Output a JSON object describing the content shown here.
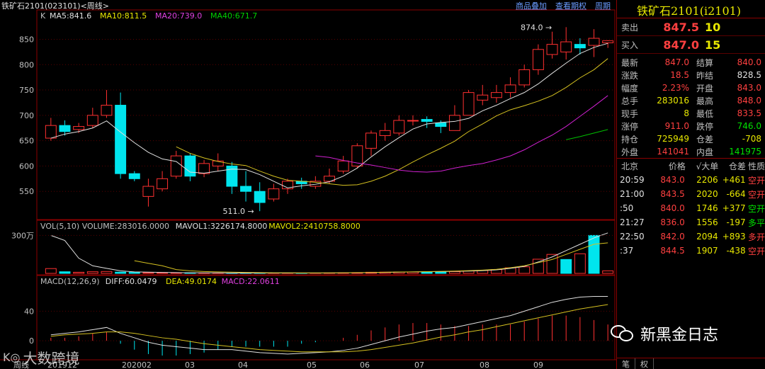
{
  "header": {
    "title": "铁矿石2101(023101)<周线>",
    "links": [
      "商品叠加",
      "查看期权",
      "周期"
    ],
    "k_label": "K"
  },
  "legends": {
    "ma": [
      {
        "text": "MA5:841.6",
        "color": "#e0e0e0"
      },
      {
        "text": "MA10:811.5",
        "color": "#e8e800"
      },
      {
        "text": "MA20:739.0",
        "color": "#e040e0"
      },
      {
        "text": "MA40:671.7",
        "color": "#00d000"
      }
    ],
    "vol": [
      {
        "text": "VOL(5,10) VOLUME:283016.0000",
        "color": "#c0c0c0"
      },
      {
        "text": "MAVOL1:3226174.8000",
        "color": "#e0e0e0"
      },
      {
        "text": "MAVOL2:2410758.8000",
        "color": "#e8e800"
      }
    ],
    "macd": [
      {
        "text": "MACD(12,26,9)",
        "color": "#c0c0c0"
      },
      {
        "text": "DIFF:60.0479",
        "color": "#e0e0e0"
      },
      {
        "text": "DEA:49.0174",
        "color": "#e8e800"
      },
      {
        "text": "MACD:22.0611",
        "color": "#e040e0"
      }
    ]
  },
  "axes": {
    "price_ticks": [
      "850",
      "800",
      "750",
      "700",
      "650",
      "600",
      "550"
    ],
    "vol_tick": "300万",
    "macd_ticks": [
      "40",
      "0"
    ],
    "x_labels": [
      "201912",
      "202002",
      "03",
      "04",
      "05",
      "06",
      "07",
      "08",
      "09"
    ],
    "x_corner": "周线"
  },
  "annotations": {
    "high": "874.0",
    "low": "511.0"
  },
  "chart_data": {
    "type": "candlestick",
    "title": "铁矿石2101(023101)<周线>",
    "ylim": [
      500,
      880
    ],
    "candles": [
      {
        "o": 655,
        "c": 680,
        "h": 695,
        "l": 650
      },
      {
        "o": 680,
        "c": 668,
        "h": 690,
        "l": 660
      },
      {
        "o": 672,
        "c": 678,
        "h": 685,
        "l": 665
      },
      {
        "o": 680,
        "c": 700,
        "h": 715,
        "l": 675
      },
      {
        "o": 700,
        "c": 720,
        "h": 750,
        "l": 695
      },
      {
        "o": 720,
        "c": 585,
        "h": 745,
        "l": 575
      },
      {
        "o": 585,
        "c": 575,
        "h": 590,
        "l": 570
      },
      {
        "o": 540,
        "c": 560,
        "h": 575,
        "l": 520
      },
      {
        "o": 555,
        "c": 575,
        "h": 590,
        "l": 550
      },
      {
        "o": 580,
        "c": 620,
        "h": 630,
        "l": 575
      },
      {
        "o": 620,
        "c": 580,
        "h": 625,
        "l": 570
      },
      {
        "o": 585,
        "c": 605,
        "h": 612,
        "l": 578
      },
      {
        "o": 600,
        "c": 610,
        "h": 625,
        "l": 590
      },
      {
        "o": 600,
        "c": 560,
        "h": 608,
        "l": 545
      },
      {
        "o": 560,
        "c": 550,
        "h": 590,
        "l": 530
      },
      {
        "o": 550,
        "c": 528,
        "h": 568,
        "l": 511
      },
      {
        "o": 535,
        "c": 555,
        "h": 565,
        "l": 530
      },
      {
        "o": 555,
        "c": 570,
        "h": 575,
        "l": 545
      },
      {
        "o": 570,
        "c": 565,
        "h": 577,
        "l": 555
      },
      {
        "o": 560,
        "c": 570,
        "h": 580,
        "l": 555
      },
      {
        "o": 570,
        "c": 580,
        "h": 595,
        "l": 565
      },
      {
        "o": 590,
        "c": 610,
        "h": 620,
        "l": 585
      },
      {
        "o": 600,
        "c": 640,
        "h": 645,
        "l": 595
      },
      {
        "o": 635,
        "c": 665,
        "h": 670,
        "l": 620
      },
      {
        "o": 660,
        "c": 670,
        "h": 685,
        "l": 650
      },
      {
        "o": 665,
        "c": 690,
        "h": 700,
        "l": 660
      },
      {
        "o": 690,
        "c": 690,
        "h": 700,
        "l": 680
      },
      {
        "o": 692,
        "c": 688,
        "h": 698,
        "l": 675
      },
      {
        "o": 685,
        "c": 678,
        "h": 690,
        "l": 665
      },
      {
        "o": 670,
        "c": 700,
        "h": 720,
        "l": 670
      },
      {
        "o": 700,
        "c": 745,
        "h": 750,
        "l": 700
      },
      {
        "o": 730,
        "c": 740,
        "h": 760,
        "l": 720
      },
      {
        "o": 735,
        "c": 745,
        "h": 760,
        "l": 725
      },
      {
        "o": 745,
        "c": 760,
        "h": 775,
        "l": 735
      },
      {
        "o": 760,
        "c": 790,
        "h": 800,
        "l": 755
      },
      {
        "o": 790,
        "c": 830,
        "h": 840,
        "l": 780
      },
      {
        "o": 820,
        "c": 840,
        "h": 865,
        "l": 812
      },
      {
        "o": 825,
        "c": 845,
        "h": 874,
        "l": 810
      },
      {
        "o": 840,
        "c": 833,
        "h": 852,
        "l": 820
      },
      {
        "o": 838,
        "c": 852,
        "h": 870,
        "l": 815
      },
      {
        "o": 843,
        "c": 847,
        "h": 848,
        "l": 833
      }
    ],
    "ma5": [
      655,
      663,
      668,
      675,
      689,
      667,
      646,
      627,
      614,
      609,
      588,
      586,
      590,
      594,
      593,
      583,
      570,
      557,
      561,
      564,
      569,
      580,
      596,
      618,
      638,
      656,
      673,
      683,
      686,
      688,
      694,
      709,
      720,
      733,
      745,
      762,
      783,
      803,
      822,
      834,
      842
    ],
    "ma10": [
      null,
      null,
      null,
      null,
      null,
      null,
      null,
      null,
      null,
      638,
      625,
      616,
      609,
      604,
      601,
      590,
      580,
      572,
      570,
      568,
      565,
      562,
      563,
      570,
      580,
      593,
      608,
      622,
      635,
      649,
      668,
      683,
      699,
      711,
      719,
      728,
      739,
      755,
      774,
      790,
      812
    ],
    "ma20": [
      null,
      null,
      null,
      null,
      null,
      null,
      null,
      null,
      null,
      null,
      null,
      null,
      null,
      null,
      null,
      null,
      null,
      null,
      null,
      620,
      617,
      611,
      606,
      602,
      597,
      592,
      589,
      588,
      590,
      596,
      601,
      605,
      612,
      620,
      632,
      647,
      661,
      678,
      698,
      718,
      739
    ],
    "ma40": [
      null,
      null,
      null,
      null,
      null,
      null,
      null,
      null,
      null,
      null,
      null,
      null,
      null,
      null,
      null,
      null,
      null,
      null,
      null,
      null,
      null,
      null,
      null,
      null,
      null,
      null,
      null,
      null,
      null,
      null,
      null,
      null,
      null,
      null,
      null,
      null,
      null,
      652,
      658,
      665,
      672
    ],
    "volume": [
      38,
      13,
      9,
      13,
      15,
      10,
      8,
      6,
      5,
      4,
      4,
      3,
      3,
      3,
      3,
      3,
      3,
      2,
      2,
      3,
      4,
      5,
      6,
      9,
      10,
      11,
      11,
      12,
      13,
      14,
      19,
      23,
      30,
      44,
      52,
      112,
      150,
      110,
      155,
      300,
      20
    ],
    "volume_up": [
      true,
      false,
      true,
      true,
      true,
      false,
      false,
      true,
      true,
      true,
      false,
      true,
      true,
      false,
      false,
      false,
      true,
      true,
      false,
      true,
      true,
      true,
      true,
      true,
      true,
      true,
      true,
      false,
      false,
      true,
      true,
      true,
      true,
      true,
      true,
      true,
      true,
      false,
      true,
      false,
      true
    ],
    "vol_ma1": [
      300,
      260,
      120,
      60,
      40,
      20,
      12,
      10,
      8,
      6,
      5,
      4,
      4,
      3,
      3,
      3,
      3,
      3,
      3,
      3,
      3,
      4,
      5,
      6,
      8,
      10,
      12,
      13,
      14,
      16,
      18,
      22,
      28,
      40,
      55,
      90,
      130,
      180,
      230,
      280,
      320
    ],
    "vol_ma2": [
      null,
      null,
      null,
      null,
      null,
      null,
      100,
      80,
      60,
      30,
      20,
      15,
      12,
      10,
      8,
      6,
      5,
      5,
      4,
      4,
      4,
      5,
      6,
      7,
      9,
      11,
      12,
      14,
      16,
      18,
      22,
      26,
      32,
      45,
      60,
      85,
      110,
      150,
      190,
      230,
      241
    ],
    "diff": [
      8,
      10,
      12,
      15,
      18,
      10,
      4,
      -2,
      -6,
      -8,
      -10,
      -12,
      -12,
      -12,
      -14,
      -16,
      -17,
      -18,
      -17,
      -16,
      -15,
      -13,
      -10,
      -5,
      0,
      5,
      9,
      13,
      16,
      18,
      22,
      26,
      30,
      34,
      40,
      46,
      52,
      56,
      59,
      60,
      60
    ],
    "dea": [
      6,
      8,
      9,
      10,
      12,
      12,
      10,
      7,
      4,
      2,
      -1,
      -4,
      -6,
      -8,
      -10,
      -12,
      -13,
      -14,
      -15,
      -15,
      -15,
      -15,
      -14,
      -12,
      -9,
      -6,
      -3,
      1,
      5,
      8,
      12,
      15,
      19,
      23,
      27,
      31,
      35,
      39,
      43,
      46,
      49
    ],
    "macd_hist": [
      4,
      4,
      6,
      10,
      12,
      -4,
      -12,
      -18,
      -20,
      -20,
      -18,
      -16,
      -12,
      -8,
      -8,
      -8,
      -8,
      -8,
      -4,
      -2,
      0,
      4,
      8,
      14,
      18,
      22,
      24,
      24,
      22,
      20,
      20,
      22,
      22,
      22,
      26,
      30,
      34,
      34,
      32,
      28,
      22
    ]
  },
  "quote": {
    "instrument": "铁矿石2101(i2101)",
    "sell": {
      "label": "卖出",
      "price": "847.5",
      "vol": "10"
    },
    "buy": {
      "label": "买入",
      "price": "847.0",
      "vol": "15"
    },
    "rows": [
      {
        "k": "最新",
        "v": "847.0",
        "vc": "red",
        "k2": "结算",
        "v2": "840.0",
        "v2c": "red"
      },
      {
        "k": "涨跌",
        "v": "18.5",
        "vc": "red",
        "k2": "昨结",
        "v2": "828.5",
        "v2c": "white"
      },
      {
        "k": "幅度",
        "v": "2.23%",
        "vc": "red",
        "k2": "开盘",
        "v2": "843.0",
        "v2c": "red"
      },
      {
        "k": "总手",
        "v": "283016",
        "vc": "yellow",
        "k2": "最高",
        "v2": "848.0",
        "v2c": "red"
      },
      {
        "k": "现手",
        "v": "8",
        "vc": "yellow",
        "k2": "最低",
        "v2": "833.5",
        "v2c": "red"
      },
      {
        "k": "涨停",
        "v": "911.0",
        "vc": "red",
        "k2": "跌停",
        "v2": "746.0",
        "v2c": "green"
      },
      {
        "k": "持仓",
        "v": "725949",
        "vc": "yellow",
        "k2": "仓差",
        "v2": "-708",
        "v2c": "yellow"
      },
      {
        "k": "外盘",
        "v": "141041",
        "vc": "red",
        "k2": "内盘",
        "v2": "141975",
        "v2c": "green"
      }
    ],
    "tick_head": [
      "北京",
      "价格",
      "√大单",
      "仓差",
      "性质"
    ],
    "ticks": [
      {
        "t": "20:59",
        "p": "843.0",
        "n": "2206",
        "d": "+461",
        "dc": "yellow",
        "nat": "空开",
        "natc": "red"
      },
      {
        "t": "21:00",
        "p": "843.5",
        "n": "2020",
        "d": "-664",
        "dc": "yellow",
        "nat": "空开",
        "natc": "red"
      },
      {
        "t": ":50",
        "p": "840.0",
        "n": "1746",
        "d": "+377",
        "dc": "yellow",
        "nat": "空开",
        "natc": "green"
      },
      {
        "t": "21:27",
        "p": "836.0",
        "n": "1556",
        "d": "-197",
        "dc": "yellow",
        "nat": "多平",
        "natc": "green"
      },
      {
        "t": "22:50",
        "p": "842.0",
        "n": "2094",
        "d": "+893",
        "dc": "yellow",
        "nat": "多开",
        "natc": "red"
      },
      {
        "t": ":37",
        "p": "844.5",
        "n": "1907",
        "d": "-438",
        "dc": "yellow",
        "nat": "空开",
        "natc": "red"
      }
    ],
    "tabs": [
      "笔",
      "权"
    ]
  },
  "watermarks": {
    "right": "新黑金日志",
    "left": "大数跨境"
  }
}
